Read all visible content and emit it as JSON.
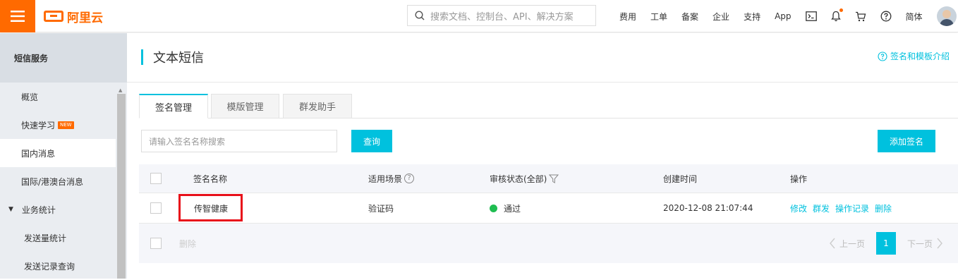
{
  "topbar": {
    "logo_text": "阿里云",
    "search_placeholder": "搜索文档、控制台、API、解决方案",
    "nav": [
      "费用",
      "工单",
      "备案",
      "企业",
      "支持",
      "App"
    ],
    "lang": "简体"
  },
  "sidebar": {
    "title": "短信服务",
    "items": [
      {
        "label": "概览"
      },
      {
        "label": "快速学习",
        "badge": "NEW"
      },
      {
        "label": "国内消息",
        "active": true
      },
      {
        "label": "国际/港澳台消息"
      },
      {
        "label": "业务统计",
        "group": true
      },
      {
        "label": "发送量统计",
        "sub": true
      },
      {
        "label": "发送记录查询",
        "sub": true
      }
    ]
  },
  "page": {
    "title": "文本短信",
    "intro_link": "签名和模板介绍"
  },
  "tabs": [
    "签名管理",
    "模版管理",
    "群发助手"
  ],
  "toolbar": {
    "search_placeholder": "请输入签名名称搜索",
    "query_button": "查询",
    "add_button": "添加签名"
  },
  "table": {
    "headers": {
      "name": "签名名称",
      "scene": "适用场景",
      "status": "审核状态(全部)",
      "created": "创建时间",
      "ops": "操作"
    },
    "rows": [
      {
        "name": "传智健康",
        "scene": "验证码",
        "status": "通过",
        "created": "2020-12-08 21:07:44",
        "ops": [
          "修改",
          "群发",
          "操作记录",
          "删除"
        ]
      }
    ],
    "footer": {
      "delete": "删除",
      "prev": "上一页",
      "page": "1",
      "next": "下一页"
    }
  },
  "colors": {
    "brand_orange": "#ff6a00",
    "accent_cyan": "#00c1de",
    "status_green": "#1fbd51",
    "highlight_red": "#e8101a"
  }
}
